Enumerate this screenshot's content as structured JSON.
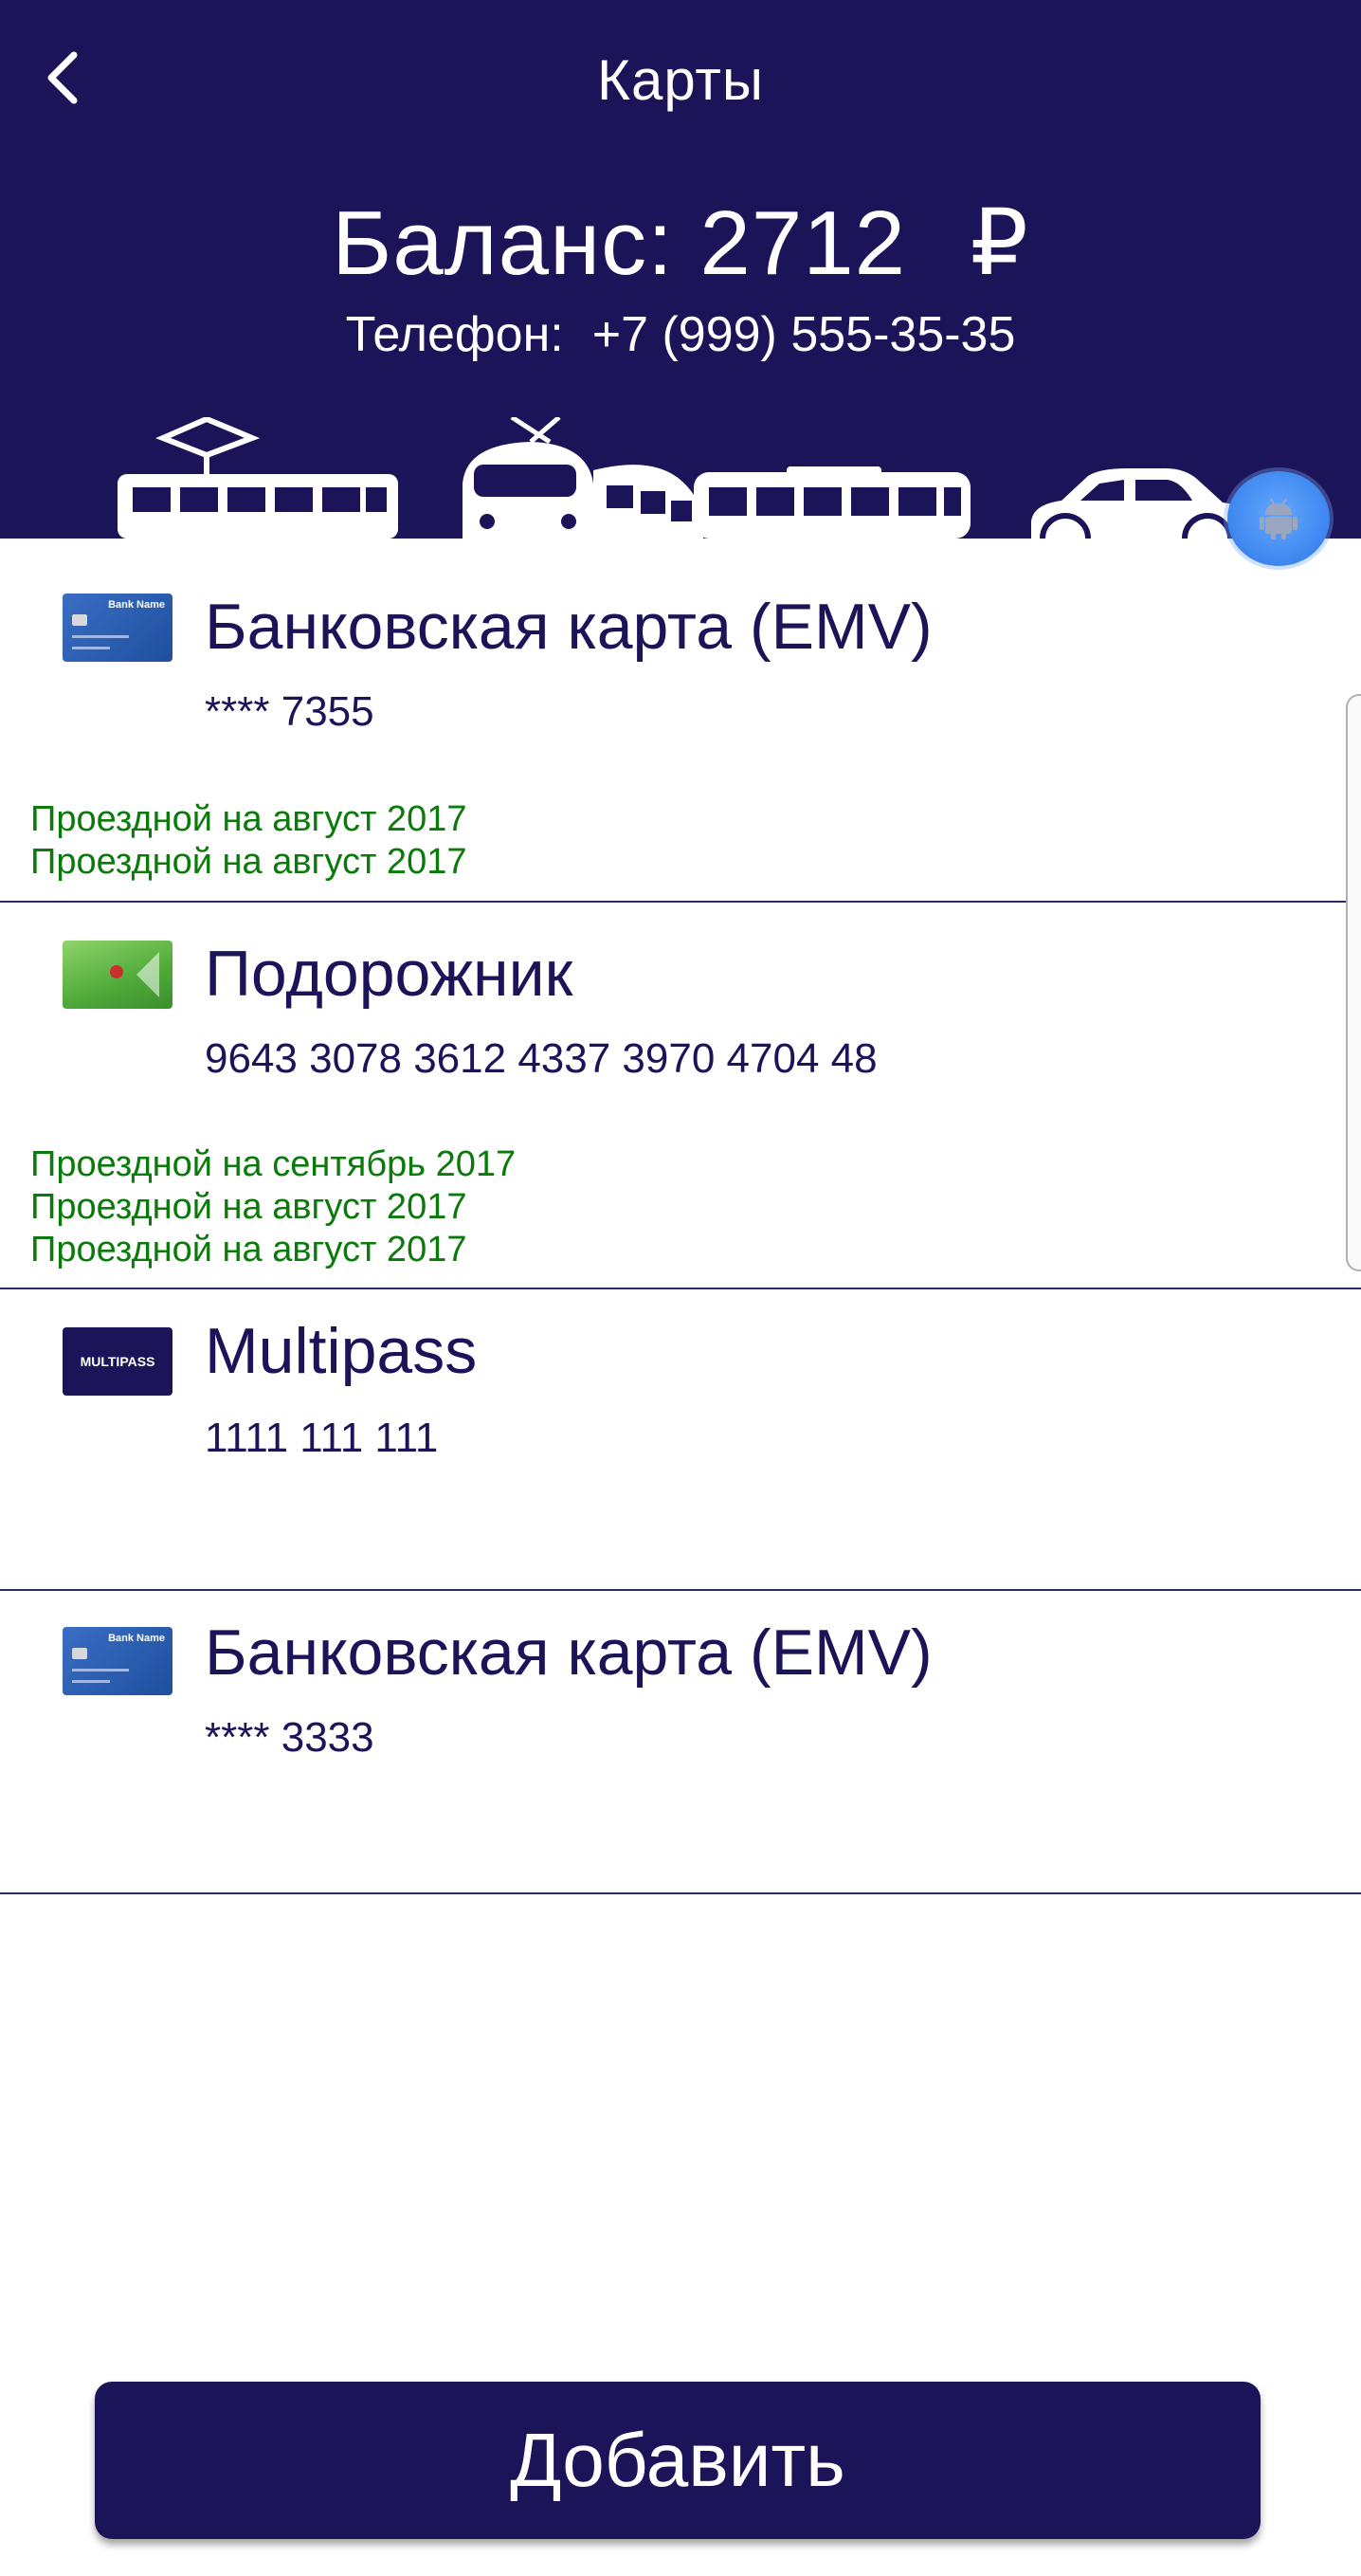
{
  "header": {
    "title": "Карты",
    "balance_label": "Баланс: 2712",
    "currency": "₽",
    "phone_label": "Телефон:",
    "phone_number": "+7 (999) 555-35-35"
  },
  "cards": [
    {
      "name": "Банковская карта (EMV)",
      "number": "**** 7355",
      "icon": "bank-card-icon",
      "icon_text": "Bank Name",
      "passes": [
        "Проездной на август 2017",
        "Проездной на август 2017"
      ]
    },
    {
      "name": "Подорожник",
      "number": "9643 3078 3612 4337 3970 4704 48",
      "icon": "podorozhnik-card-icon",
      "passes": [
        "Проездной на сентябрь 2017",
        "Проездной на август 2017",
        "Проездной на август 2017"
      ]
    },
    {
      "name": "Multipass",
      "number": "1111 111 111",
      "icon": "multipass-card-icon",
      "icon_text": "MULTIPASS",
      "passes": []
    },
    {
      "name": "Банковская карта (EMV)",
      "number": "**** 3333",
      "icon": "bank-card-icon",
      "icon_text": "Bank Name",
      "passes": []
    }
  ],
  "add_button": "Добавить",
  "colors": {
    "primary": "#1c1458",
    "pass_text": "#0a7a0a",
    "fab": "#3d86ee"
  }
}
